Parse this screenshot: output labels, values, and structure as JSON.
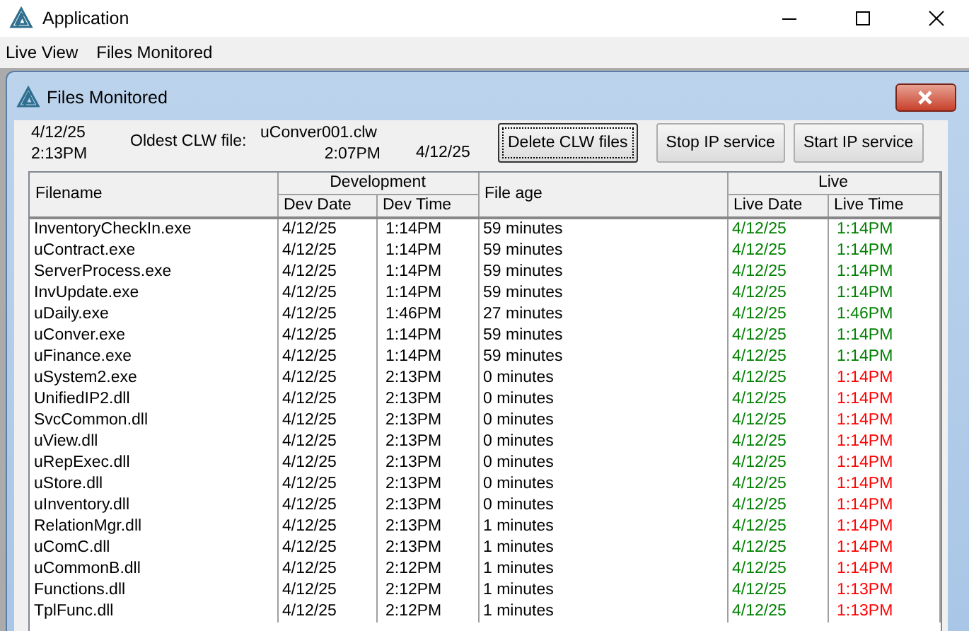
{
  "window": {
    "title": "Application"
  },
  "menu": [
    "Live View",
    "Files Monitored"
  ],
  "child_window": {
    "title": "Files Monitored"
  },
  "info": {
    "current_date": "4/12/25",
    "current_time": "2:13PM",
    "oldest_label": "Oldest CLW file:",
    "oldest_file": "uConver001.clw",
    "oldest_time": "2:07PM",
    "oldest_date": "4/12/25"
  },
  "buttons": [
    {
      "label": "Delete CLW files",
      "focused": true
    },
    {
      "label": "Stop IP service",
      "focused": false
    },
    {
      "label": "Start IP service",
      "focused": false
    }
  ],
  "table": {
    "groups": [
      "Development",
      "Live"
    ],
    "columns": [
      "Filename",
      "Dev Date",
      "Dev Time",
      "File age",
      "Live Date",
      "Live Time"
    ],
    "rows": [
      {
        "filename": "InventoryCheckIn.exe",
        "dev_date": "4/12/25",
        "dev_time": "1:14PM",
        "file_age": "59 minutes",
        "live_date": {
          "text": "4/12/25",
          "color": "#008000"
        },
        "live_time": {
          "text": "1:14PM",
          "color": "#008000"
        }
      },
      {
        "filename": "uContract.exe",
        "dev_date": "4/12/25",
        "dev_time": "1:14PM",
        "file_age": "59 minutes",
        "live_date": {
          "text": "4/12/25",
          "color": "#008000"
        },
        "live_time": {
          "text": "1:14PM",
          "color": "#008000"
        }
      },
      {
        "filename": "ServerProcess.exe",
        "dev_date": "4/12/25",
        "dev_time": "1:14PM",
        "file_age": "59 minutes",
        "live_date": {
          "text": "4/12/25",
          "color": "#008000"
        },
        "live_time": {
          "text": "1:14PM",
          "color": "#008000"
        }
      },
      {
        "filename": "InvUpdate.exe",
        "dev_date": "4/12/25",
        "dev_time": "1:14PM",
        "file_age": "59 minutes",
        "live_date": {
          "text": "4/12/25",
          "color": "#008000"
        },
        "live_time": {
          "text": "1:14PM",
          "color": "#008000"
        }
      },
      {
        "filename": "uDaily.exe",
        "dev_date": "4/12/25",
        "dev_time": "1:46PM",
        "file_age": "27 minutes",
        "live_date": {
          "text": "4/12/25",
          "color": "#008000"
        },
        "live_time": {
          "text": "1:46PM",
          "color": "#008000"
        }
      },
      {
        "filename": "uConver.exe",
        "dev_date": "4/12/25",
        "dev_time": "1:14PM",
        "file_age": "59 minutes",
        "live_date": {
          "text": "4/12/25",
          "color": "#008000"
        },
        "live_time": {
          "text": "1:14PM",
          "color": "#008000"
        }
      },
      {
        "filename": "uFinance.exe",
        "dev_date": "4/12/25",
        "dev_time": "1:14PM",
        "file_age": "59 minutes",
        "live_date": {
          "text": "4/12/25",
          "color": "#008000"
        },
        "live_time": {
          "text": "1:14PM",
          "color": "#008000"
        }
      },
      {
        "filename": "uSystem2.exe",
        "dev_date": "4/12/25",
        "dev_time": "2:13PM",
        "file_age": "0 minutes",
        "live_date": {
          "text": "4/12/25",
          "color": "#008000"
        },
        "live_time": {
          "text": "1:14PM",
          "color": "#ff0000"
        }
      },
      {
        "filename": "UnifiedIP2.dll",
        "dev_date": "4/12/25",
        "dev_time": "2:13PM",
        "file_age": "0 minutes",
        "live_date": {
          "text": "4/12/25",
          "color": "#008000"
        },
        "live_time": {
          "text": "1:14PM",
          "color": "#ff0000"
        }
      },
      {
        "filename": "SvcCommon.dll",
        "dev_date": "4/12/25",
        "dev_time": "2:13PM",
        "file_age": "0 minutes",
        "live_date": {
          "text": "4/12/25",
          "color": "#008000"
        },
        "live_time": {
          "text": "1:14PM",
          "color": "#ff0000"
        }
      },
      {
        "filename": "uView.dll",
        "dev_date": "4/12/25",
        "dev_time": "2:13PM",
        "file_age": "0 minutes",
        "live_date": {
          "text": "4/12/25",
          "color": "#008000"
        },
        "live_time": {
          "text": "1:14PM",
          "color": "#ff0000"
        }
      },
      {
        "filename": "uRepExec.dll",
        "dev_date": "4/12/25",
        "dev_time": "2:13PM",
        "file_age": "0 minutes",
        "live_date": {
          "text": "4/12/25",
          "color": "#008000"
        },
        "live_time": {
          "text": "1:14PM",
          "color": "#ff0000"
        }
      },
      {
        "filename": "uStore.dll",
        "dev_date": "4/12/25",
        "dev_time": "2:13PM",
        "file_age": "0 minutes",
        "live_date": {
          "text": "4/12/25",
          "color": "#008000"
        },
        "live_time": {
          "text": "1:14PM",
          "color": "#ff0000"
        }
      },
      {
        "filename": "uInventory.dll",
        "dev_date": "4/12/25",
        "dev_time": "2:13PM",
        "file_age": "0 minutes",
        "live_date": {
          "text": "4/12/25",
          "color": "#008000"
        },
        "live_time": {
          "text": "1:14PM",
          "color": "#ff0000"
        }
      },
      {
        "filename": "RelationMgr.dll",
        "dev_date": "4/12/25",
        "dev_time": "2:13PM",
        "file_age": "1 minutes",
        "live_date": {
          "text": "4/12/25",
          "color": "#008000"
        },
        "live_time": {
          "text": "1:14PM",
          "color": "#ff0000"
        }
      },
      {
        "filename": "uComC.dll",
        "dev_date": "4/12/25",
        "dev_time": "2:13PM",
        "file_age": "1 minutes",
        "live_date": {
          "text": "4/12/25",
          "color": "#008000"
        },
        "live_time": {
          "text": "1:14PM",
          "color": "#ff0000"
        }
      },
      {
        "filename": "uCommonB.dll",
        "dev_date": "4/12/25",
        "dev_time": "2:12PM",
        "file_age": "1 minutes",
        "live_date": {
          "text": "4/12/25",
          "color": "#008000"
        },
        "live_time": {
          "text": "1:14PM",
          "color": "#ff0000"
        }
      },
      {
        "filename": "Functions.dll",
        "dev_date": "4/12/25",
        "dev_time": "2:12PM",
        "file_age": "1 minutes",
        "live_date": {
          "text": "4/12/25",
          "color": "#008000"
        },
        "live_time": {
          "text": "1:13PM",
          "color": "#ff0000"
        }
      },
      {
        "filename": "TplFunc.dll",
        "dev_date": "4/12/25",
        "dev_time": "2:12PM",
        "file_age": "1 minutes",
        "live_date": {
          "text": "4/12/25",
          "color": "#008000"
        },
        "live_time": {
          "text": "1:13PM",
          "color": "#ff0000"
        }
      }
    ]
  }
}
